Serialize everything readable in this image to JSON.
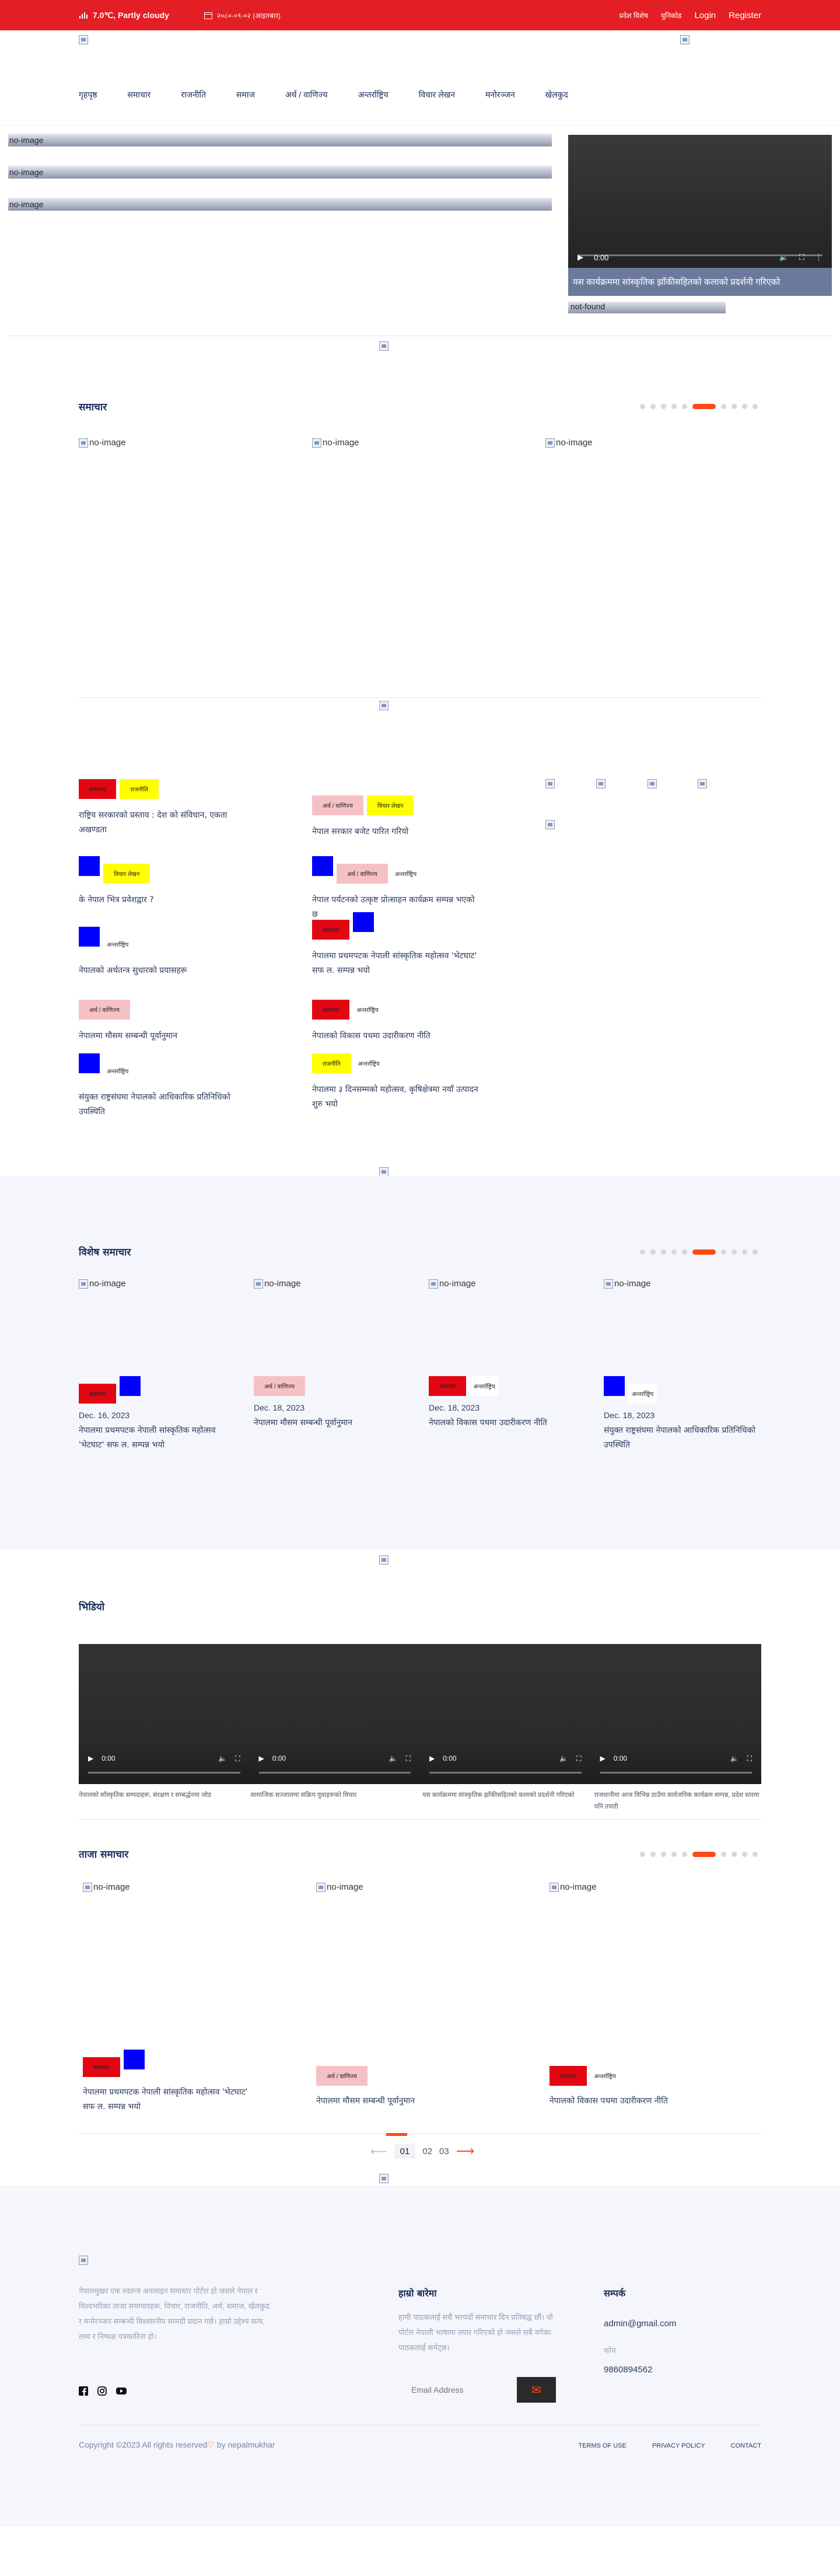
{
  "topbar": {
    "weather": "7.0℃, Partly cloudy",
    "date": "२०८०-०९-०२ (आइतबार)",
    "links": [
      "प्रदेश विशेष",
      "युनिकोड"
    ],
    "login": "Login",
    "register": "Register"
  },
  "nav": {
    "items": [
      "गृहपृष्ठ",
      "समाचार",
      "राजनीति",
      "समाज",
      "अर्थ / वाणिज्य",
      "अन्तर्राष्ट्रिय",
      "विचार लेखन",
      "मनोरञ्जन",
      "खेलकुद"
    ]
  },
  "hero": {
    "bars": [
      "no-image",
      "no-image",
      "no-image"
    ],
    "video_time": "0:00",
    "caption": "यस कार्यक्रममा सांस्कृतिक झाँकीसहितको कलाको प्रदर्शनी गरिएको",
    "notfound": "not-found"
  },
  "slider1": {
    "title": "समाचार",
    "items": [
      "no-image",
      "no-image",
      "no-image"
    ]
  },
  "news": {
    "left": [
      {
        "tags": [
          {
            "label": "समाचार",
            "color": "red"
          },
          {
            "label": "राजनीति",
            "color": "yellow"
          }
        ],
        "title": "राष्ट्रिय सरकारको प्रस्ताव : देश को संविधान, एकता अखण्डता"
      },
      {
        "tags": [
          {
            "label": "",
            "color": "blue"
          },
          {
            "label": "विचार लेखन",
            "color": "yellow"
          }
        ],
        "title": "के नेपाल भित्र प्रवेशद्वार ?"
      },
      {
        "tags": [
          {
            "label": "",
            "color": "blue"
          },
          {
            "label": "अन्तर्राष्ट्रिय",
            "color": "plain"
          }
        ],
        "title": "नेपालको अर्थतन्त्र सुधारको प्रयासहरू"
      },
      {
        "tags": [
          {
            "label": "अर्थ / वाणिज्य",
            "color": "pink"
          }
        ],
        "title": "नेपालमा मौसम सम्बन्धी पूर्वानुमान"
      },
      {
        "tags": [
          {
            "label": "",
            "color": "blue"
          },
          {
            "label": "अन्तर्राष्ट्रिय",
            "color": "plain"
          }
        ],
        "title": "संयुक्त राष्ट्रसंघमा नेपालको आधिकारिक प्रतिनिधिको उपस्थिति"
      }
    ],
    "mid": [
      {
        "tags": [
          {
            "label": "अर्थ / वाणिज्य",
            "color": "pink"
          },
          {
            "label": "विचार लेखन",
            "color": "yellow"
          }
        ],
        "title": "नेपाल सरकार बजेट पारित गरियो"
      },
      {
        "tags": [
          {
            "label": "",
            "color": "blue"
          },
          {
            "label": "अर्थ / वाणिज्य",
            "color": "pink"
          },
          {
            "label": "अन्तर्राष्ट्रिय",
            "color": "plain"
          }
        ],
        "title": "नेपाल पर्यटनको उत्कृष्ट प्रोत्साहन कार्यक्रम सम्पन्न भएको छ"
      },
      {
        "tags": [
          {
            "label": "समाचार",
            "color": "red"
          },
          {
            "label": "",
            "color": "blue"
          }
        ],
        "title": "नेपालमा प्रथमपटक नेपाली सांस्कृतिक महोत्सव 'भेटघाट' सफ ल. सम्पन्न भयो"
      },
      {
        "tags": [
          {
            "label": "समाचार",
            "color": "red"
          },
          {
            "label": "अन्तर्राष्ट्रिय",
            "color": "plain"
          }
        ],
        "title": "नेपालको विकास पथमा उदारीकरण नीति"
      },
      {
        "tags": [
          {
            "label": "राजनीति",
            "color": "yellow"
          },
          {
            "label": "अन्तर्राष्ट्रिय",
            "color": "plain"
          }
        ],
        "title": "नेपालमा ३ दिनसम्मको महोत्सव, कृषिक्षेत्रमा नयाँ उत्पादन शुरु भयो"
      }
    ]
  },
  "featured": {
    "title": "विशेष समाचार",
    "cards": [
      {
        "img": "no-image",
        "tags": [
          {
            "label": "समाचार",
            "color": "red"
          },
          {
            "label": "",
            "color": "blue"
          }
        ],
        "date": "Dec. 16, 2023",
        "title": "नेपालमा प्रथमपटक नेपाली सांस्कृतिक महोत्सव 'भेटघाट' सफ ल. सम्पन्न भयो"
      },
      {
        "img": "no-image",
        "tags": [
          {
            "label": "अर्थ / वाणिज्य",
            "color": "pink"
          }
        ],
        "date": "Dec. 18, 2023",
        "title": "नेपालमा मौसम सम्बन्धी पूर्वानुमान"
      },
      {
        "img": "no-image",
        "tags": [
          {
            "label": "समाचार",
            "color": "red"
          },
          {
            "label": "अन्तर्राष्ट्रिय",
            "color": "plain"
          }
        ],
        "date": "Dec. 18, 2023",
        "title": "नेपालको विकास पथमा उदारीकरण नीति"
      },
      {
        "img": "no-image",
        "tags": [
          {
            "label": "",
            "color": "blue"
          },
          {
            "label": "अन्तर्राष्ट्रिय",
            "color": "plain"
          }
        ],
        "date": "Dec. 18, 2023",
        "title": "संयुक्त राष्ट्रसंघमा नेपालको आधिकारिक प्रतिनिधिको उपस्थिति"
      }
    ]
  },
  "videos": {
    "title": "भिडियो",
    "time": "0:00",
    "captions": [
      "नेपालको साँस्कृतिक सम्पदाहरू, संरक्षण र सम्बर्द्धनमा जोड",
      "सामाजिक सञ्जालमा सक्रिय युवाहरूको विचार",
      "यस कार्यक्रममा सांस्कृतिक झाँकीसहितको कलाको प्रदर्शनी गरिएको",
      "राजधानीमा आज विभिन्न ठाउँमा सार्वजनिक कार्यक्रम सम्पन्न, प्रदेश स्तरमा पनि तयारी"
    ]
  },
  "latest": {
    "title": "ताजा समाचार",
    "cards": [
      {
        "img": "no-image",
        "tags": [
          {
            "label": "समाचार",
            "color": "red"
          },
          {
            "label": "",
            "color": "blue"
          }
        ],
        "title": "नेपालमा प्रथमपटक नेपाली सांस्कृतिक महोत्सव 'भेटघाट' सफ ल. सम्पन्न भयो"
      },
      {
        "img": "no-image",
        "tags": [
          {
            "label": "अर्थ / वाणिज्य",
            "color": "pink"
          }
        ],
        "title": "नेपालमा मौसम सम्बन्धी पूर्वानुमान"
      },
      {
        "img": "no-image",
        "tags": [
          {
            "label": "समाचार",
            "color": "red"
          },
          {
            "label": "अन्तर्राष्ट्रिय",
            "color": "plain"
          }
        ],
        "title": "नेपालको विकास पथमा उदारीकरण नीति"
      }
    ],
    "pages": [
      "01",
      "02",
      "03"
    ]
  },
  "footer": {
    "about": "नेपालमुखर एक स्वतन्त्र अनलाइन समाचार पोर्टल हो जसले नेपाल र विश्वभरिका ताजा समाचारहरू, विचार, राजनीति, अर्थ, समाज, खेलकुद र मनोरञ्जन सम्बन्धी विश्वसनीय सामग्री प्रदान गर्छ। हाम्रो उद्देश्य सत्य, तथ्य र निष्पक्ष पत्रकारिता हो।",
    "col2_title": "हाम्रो बारेमा",
    "col2_text": "हामी पाठकलाई सधैं भरपर्दो समाचार दिन प्रतिबद्ध छौं। यो पोर्टल नेपाली भाषामा तयार गरिएको हो जसले सबै वर्गका पाठकलाई समेट्छ।",
    "col3_title": "सम्पर्क",
    "email": "admin@gmail.com",
    "phone_label": "फोन",
    "phone": "9860894562",
    "email_placeholder": "Email Address",
    "copyright": "Copyright ©2023 All rights reserved",
    "by": " by nepalmukhar",
    "links": [
      "TERMS OF USE",
      "PRIVACY POLICY",
      "CONTACT"
    ],
    "social": [
      "facebook-icon",
      "instagram-icon",
      "youtube-icon"
    ]
  }
}
